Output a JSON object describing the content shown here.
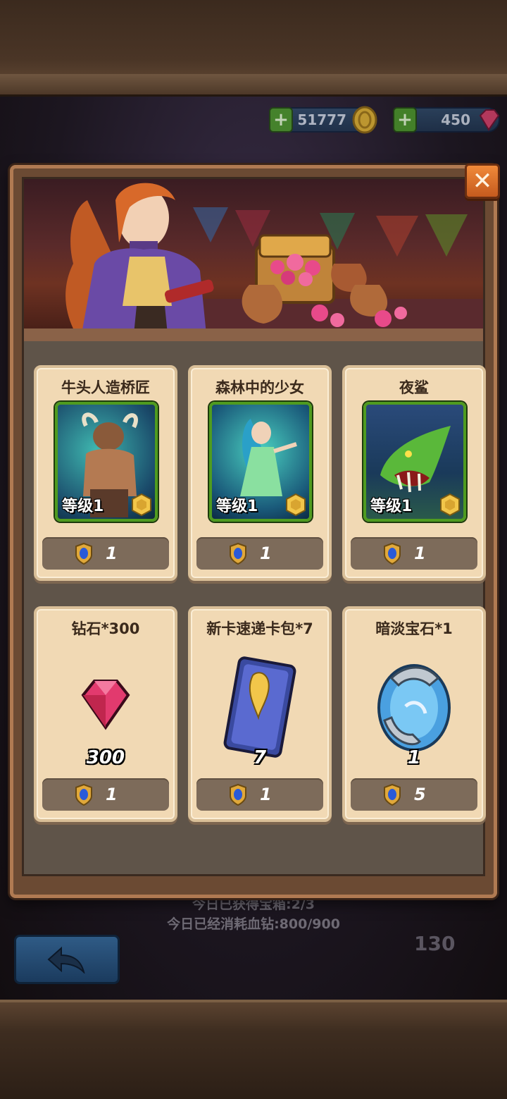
{
  "resources": {
    "gold": "51777",
    "diamonds": "450"
  },
  "modal": {
    "close_glyph": "✕",
    "cards": [
      {
        "name": "牛头人造桥匠",
        "level": "等级1",
        "price": "1",
        "art": "minotaur"
      },
      {
        "name": "森林中的少女",
        "level": "等级1",
        "price": "1",
        "art": "forest-maiden"
      },
      {
        "name": "夜鲨",
        "level": "等级1",
        "price": "1",
        "art": "night-shark"
      }
    ],
    "items": [
      {
        "name": "钻石*300",
        "quantity": "300",
        "price": "1",
        "icon": "diamond-icon"
      },
      {
        "name": "新卡速递卡包*7",
        "quantity": "7",
        "price": "1",
        "icon": "card-pack-icon"
      },
      {
        "name": "暗淡宝石*1",
        "quantity": "1",
        "price": "5",
        "icon": "dim-gem-icon"
      }
    ]
  },
  "background_info": {
    "line1": "今日已获得宝箱:2/3",
    "line2": "今日已经消耗血钻:800/900",
    "side_count": "130"
  },
  "colors": {
    "card_bg": "#f1d9b4",
    "price_bar": "#7d6b5a",
    "close_button": "#e8772e",
    "level_border": "#4f9b1f"
  }
}
